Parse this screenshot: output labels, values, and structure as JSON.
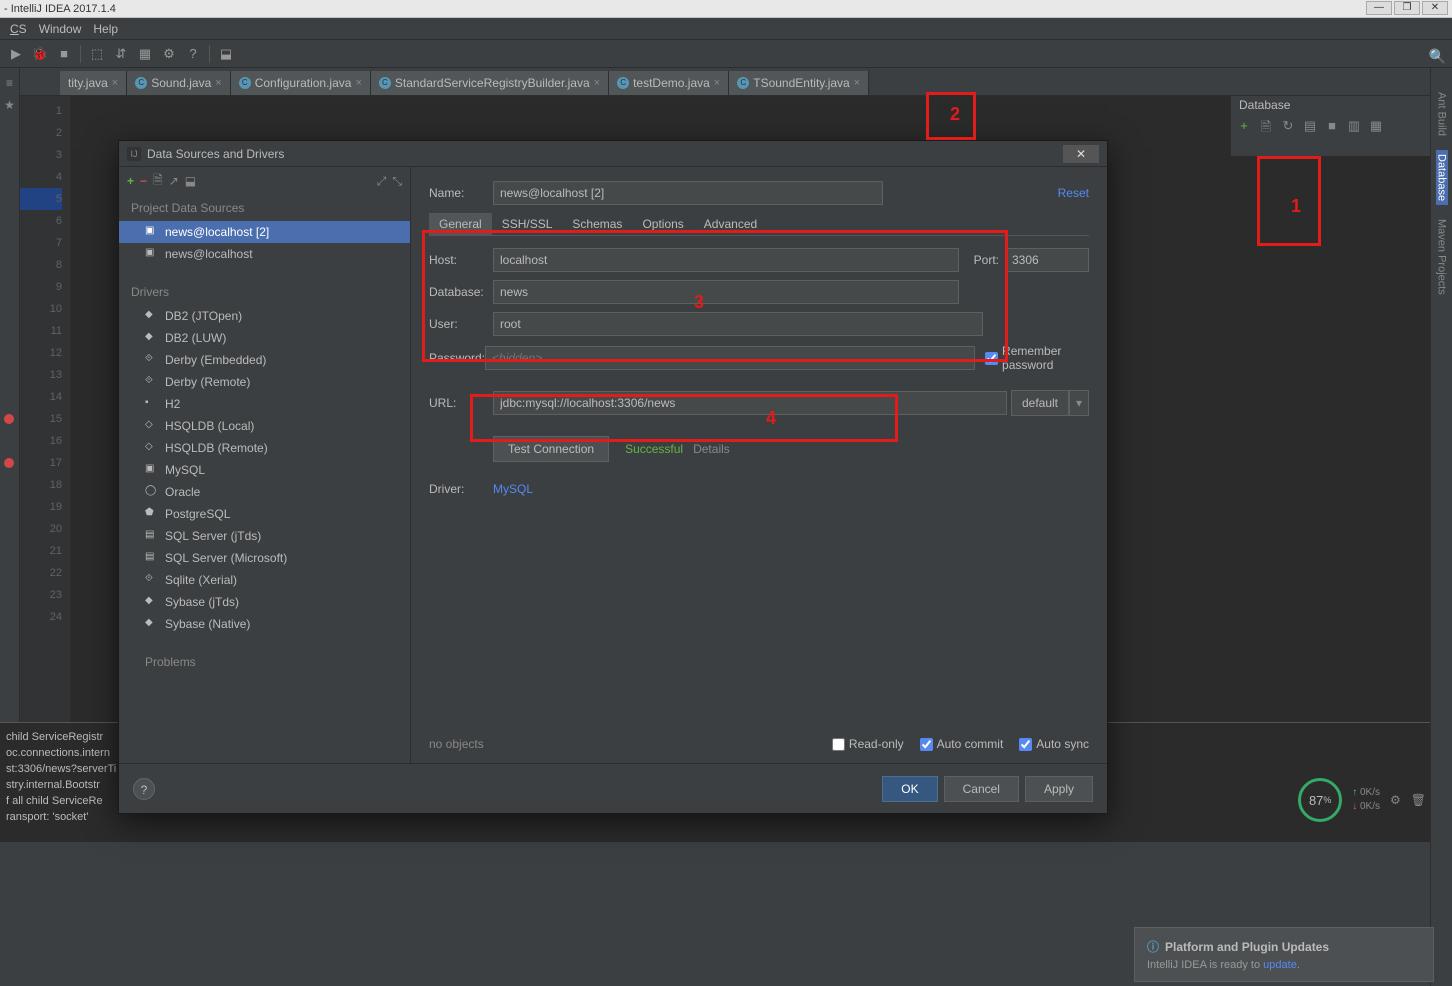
{
  "titlebar": "- IntelliJ IDEA 2017.1.4",
  "menubar": [
    "CS",
    "Window",
    "Help"
  ],
  "tabs": [
    {
      "name": "tity.java",
      "icon": "c"
    },
    {
      "name": "Sound.java",
      "icon": "c"
    },
    {
      "name": "Configuration.java",
      "icon": "c"
    },
    {
      "name": "StandardServiceRegistryBuilder.java",
      "icon": "c"
    },
    {
      "name": "testDemo.java",
      "icon": "c"
    },
    {
      "name": "TSoundEntity.java",
      "icon": "c"
    }
  ],
  "gutter": [
    "1",
    "2",
    "3",
    "4",
    "5",
    "6",
    "7",
    "8",
    "9",
    "10",
    "11",
    "12",
    "13",
    "14",
    "15",
    "16",
    "17",
    "18",
    "19",
    "20",
    "21",
    "22",
    "23",
    "24"
  ],
  "breakpoints": [
    15,
    17
  ],
  "highlighted_line": 5,
  "right_tw": {
    "title": "Database"
  },
  "right_bar": [
    "Ant Build",
    "Database",
    "Maven Projects"
  ],
  "console_lines": [
    " child ServiceRegistr",
    "oc.connections.intern",
    "st:3306/news?serverTi",
    "stry.internal.Bootstr",
    "f all child ServiceRe",
    "ransport: 'socket'"
  ],
  "dialog": {
    "title": "Data Sources and Drivers",
    "name_label": "Name:",
    "name_value": "news@localhost [2]",
    "reset": "Reset",
    "left_sections": {
      "pds": "Project Data Sources",
      "pds_items": [
        "news@localhost [2]",
        "news@localhost"
      ],
      "drv": "Drivers",
      "drv_items": [
        "DB2 (JTOpen)",
        "DB2 (LUW)",
        "Derby (Embedded)",
        "Derby (Remote)",
        "H2",
        "HSQLDB (Local)",
        "HSQLDB (Remote)",
        "MySQL",
        "Oracle",
        "PostgreSQL",
        "SQL Server (jTds)",
        "SQL Server (Microsoft)",
        "Sqlite (Xerial)",
        "Sybase (jTds)",
        "Sybase (Native)"
      ],
      "problems": "Problems"
    },
    "tabs": [
      "General",
      "SSH/SSL",
      "Schemas",
      "Options",
      "Advanced"
    ],
    "fields": {
      "host_l": "Host:",
      "host_v": "localhost",
      "port_l": "Port:",
      "port_v": "3306",
      "db_l": "Database:",
      "db_v": "news",
      "user_l": "User:",
      "user_v": "root",
      "pw_l": "Password:",
      "pw_ph": "<hidden>",
      "remember": "Remember password",
      "url_l": "URL:",
      "url_v": "jdbc:mysql://localhost:3306/news",
      "url_mode": "default",
      "test": "Test Connection",
      "succ": "Successful",
      "details": "Details",
      "driver_l": "Driver:",
      "driver_v": "MySQL"
    },
    "footer": {
      "no_objects": "no objects",
      "readonly": "Read-only",
      "autocommit": "Auto commit",
      "autosync": "Auto sync",
      "ok": "OK",
      "cancel": "Cancel",
      "apply": "Apply"
    }
  },
  "annotations": {
    "1": "1",
    "2": "2",
    "3": "3",
    "4": "4"
  },
  "notif": {
    "title": "Platform and Plugin Updates",
    "body_a": "IntelliJ IDEA is ready to ",
    "link": "update",
    "body_b": "."
  },
  "perf": {
    "pct": "87",
    "unit": "%",
    "up": "0K/s",
    "down": "0K/s"
  }
}
